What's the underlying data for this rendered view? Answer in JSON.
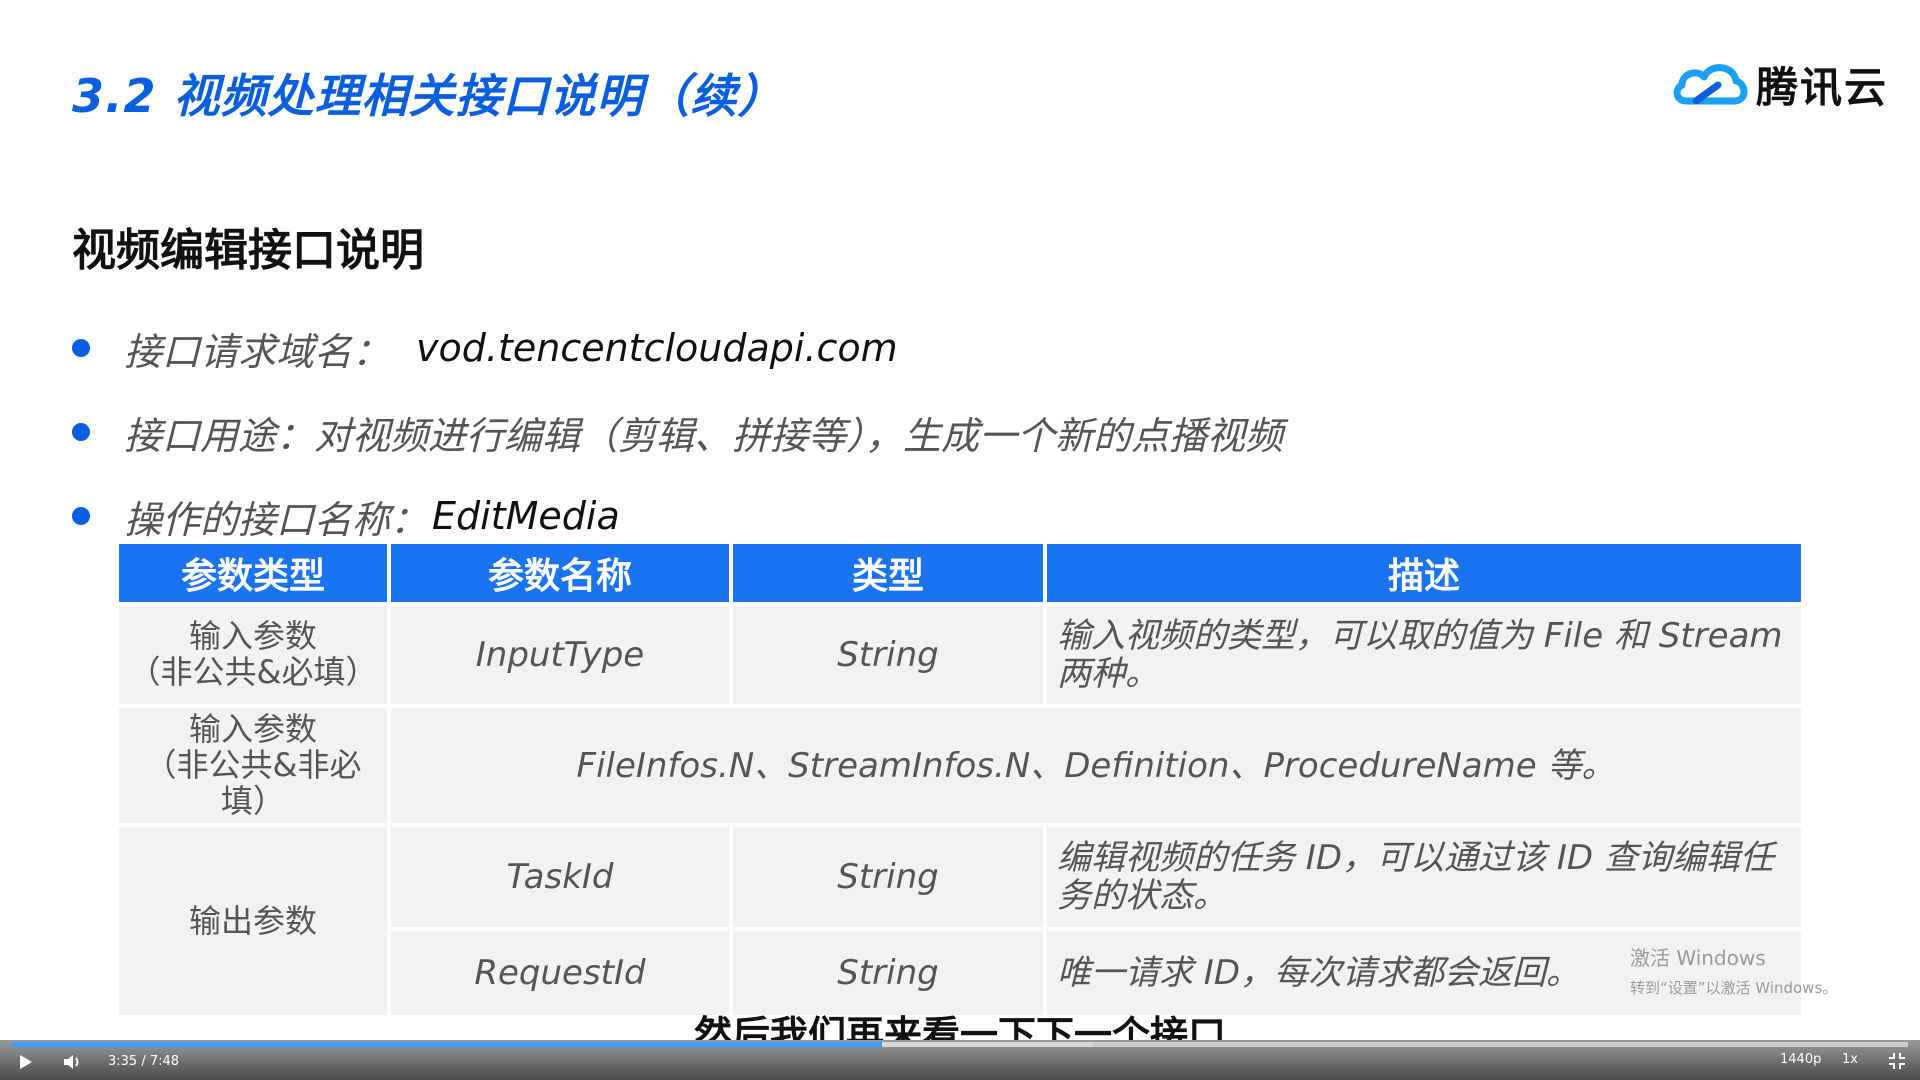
{
  "slide": {
    "title": "3.2 视频处理相关接口说明（续）",
    "logo_text": "腾讯云",
    "section_heading": "视频编辑接口说明",
    "bullets": [
      {
        "label": "接口请求域名：",
        "value": "vod.tencentcloudapi.com"
      },
      {
        "label": "接口用途：对视频进行编辑（剪辑、拼接等），生成一个新的点播视频",
        "value": ""
      },
      {
        "label": "操作的接口名称：",
        "value": "EditMedia"
      }
    ],
    "table": {
      "headers": [
        "参数类型",
        "参数名称",
        "类型",
        "描述"
      ],
      "rows": [
        {
          "param_type": "输入参数\n（非公共&必填）",
          "name": "InputType",
          "type": "String",
          "desc": "输入视频的类型，可以取的值为 File 和 Stream 两种。"
        },
        {
          "param_type": "输入参数\n（非公共&非必填）",
          "merged": "FileInfos.N、StreamInfos.N、Definition、ProcedureName 等。"
        },
        {
          "param_type": "输出参数",
          "name": "TaskId",
          "type": "String",
          "desc": "编辑视频的任务 ID，可以通过该 ID 查询编辑任务的状态。"
        },
        {
          "name": "RequestId",
          "type": "String",
          "desc": "唯一请求 ID，每次请求都会返回。"
        }
      ]
    }
  },
  "watermark": {
    "line1": "激活 Windows",
    "line2": "转到“设置”以激活 Windows。"
  },
  "subtitle": "然后我们再来看一下下一个接口",
  "player": {
    "time": "3:35 / 7:48",
    "quality": "1440p",
    "speed": "1x",
    "progress": 0.459,
    "buffered": 0.57,
    "accent_color": "#3aa0ff"
  },
  "colors": {
    "title": "#0a5fe0",
    "header": "#1a73f0",
    "cell": "#f2f2f2"
  }
}
